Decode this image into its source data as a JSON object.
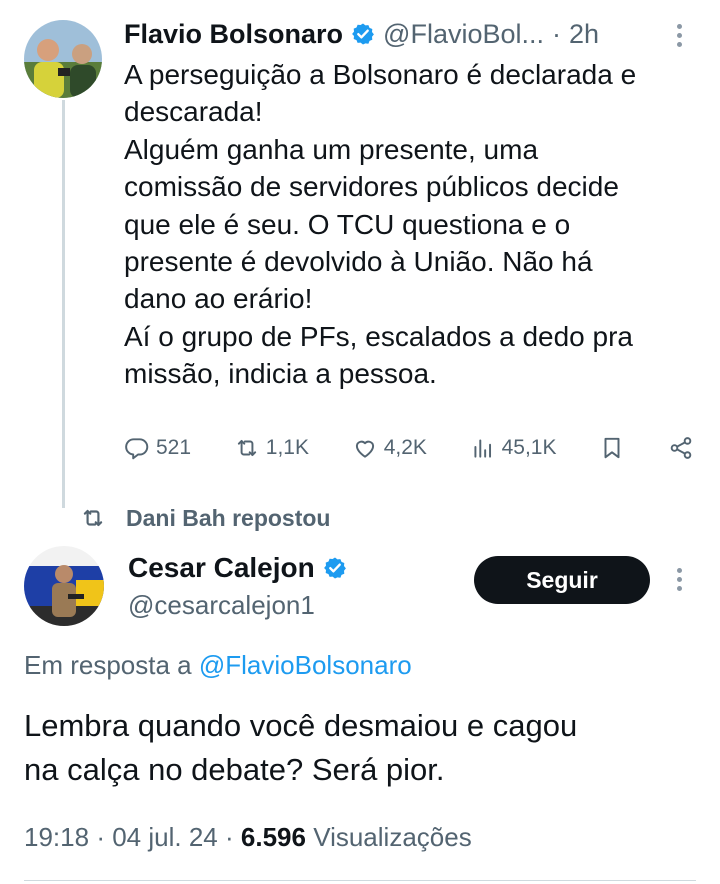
{
  "quoted_tweet": {
    "author_name": "Flavio Bolsonaro",
    "author_handle": "@FlavioBol...",
    "separator": "·",
    "time": "2h",
    "text": "A perseguição a Bolsonaro é declarada e\ndescarada!\nAlguém ganha um presente, uma\ncomissão de servidores públicos decide\nque ele é seu. O TCU questiona e o\npresente é devolvido à União. Não há\ndano ao erário!\nAí o grupo de PFs, escalados a dedo pra\nmissão, indicia a pessoa.",
    "actions": {
      "replies": "521",
      "reposts": "1,1K",
      "likes": "4,2K",
      "views": "45,1K"
    }
  },
  "repost_banner": {
    "text": "Dani Bah repostou"
  },
  "main_tweet": {
    "author_name": "Cesar Calejon",
    "author_handle": "@cesarcalejon1",
    "follow_label": "Seguir",
    "reply_prefix": "Em resposta a",
    "reply_to": "@FlavioBolsonaro",
    "text": "Lembra quando você desmaiou e cagou\nna calça no debate? Será pior.",
    "time": "19:18",
    "date": "04 jul. 24",
    "views_count": "6.596",
    "views_label": "Visualizações"
  },
  "colors": {
    "verified": "#1d9bf0",
    "link": "#1d9bf0",
    "muted": "#536471",
    "text": "#0f1419"
  }
}
